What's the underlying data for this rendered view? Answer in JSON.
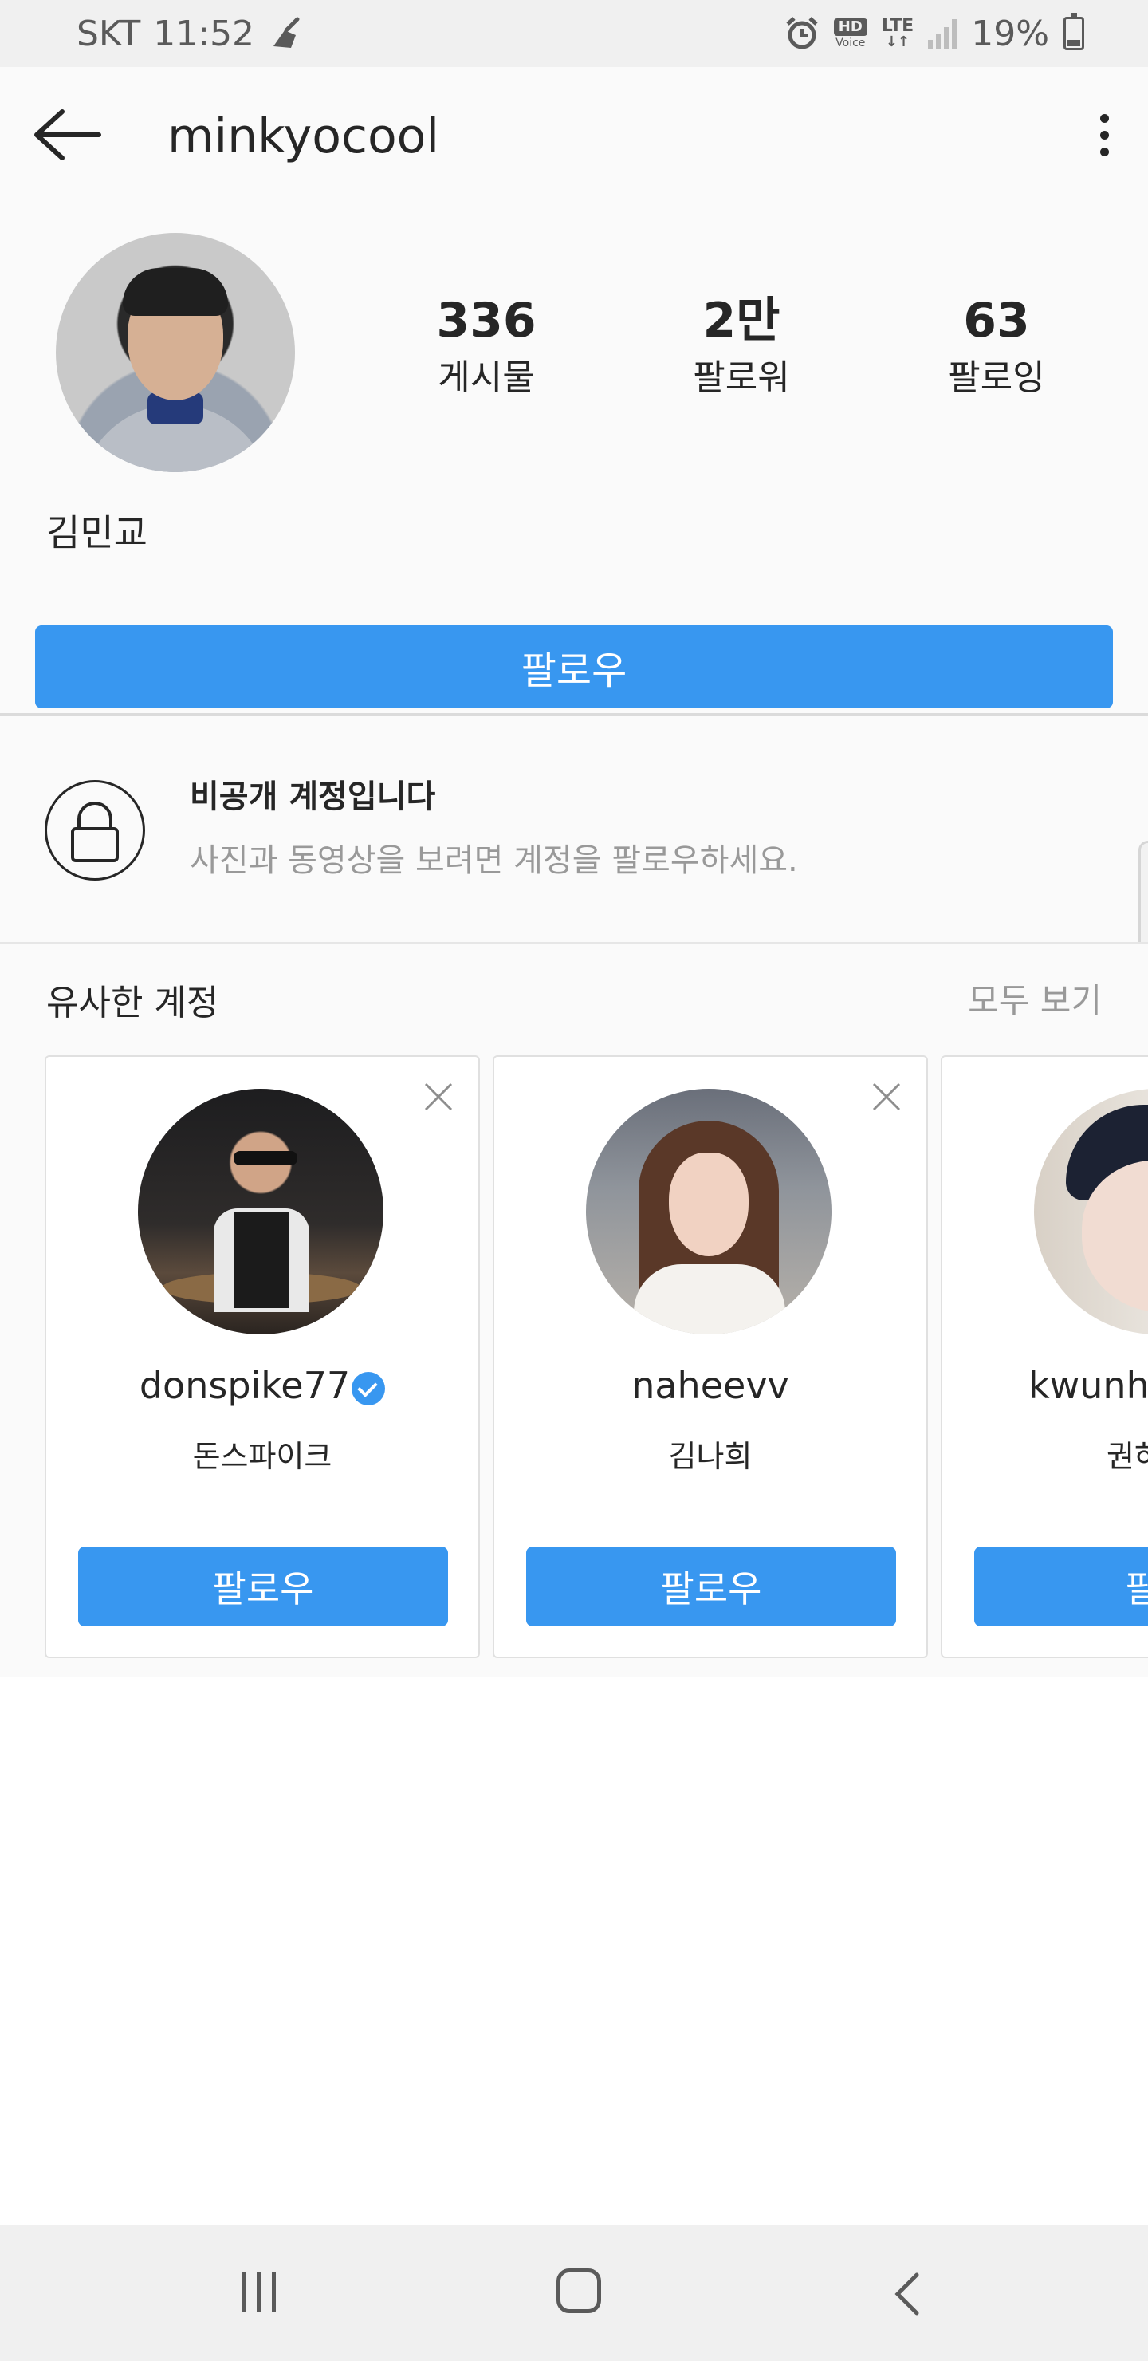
{
  "status_bar": {
    "carrier": "SKT",
    "time": "11:52",
    "hd_label": "HD",
    "voice_label": "Voice",
    "lte_label": "LTE",
    "battery": "19%"
  },
  "top_bar": {
    "username": "minkyocool"
  },
  "profile": {
    "stats": [
      {
        "value": "336",
        "label": "게시물"
      },
      {
        "value": "2만",
        "label": "팔로워"
      },
      {
        "value": "63",
        "label": "팔로잉"
      }
    ],
    "full_name": "김민교",
    "follow_label": "팔로우"
  },
  "private_notice": {
    "title": "비공개 계정입니다",
    "subtitle": "사진과 동영상을 보려면 계정을 팔로우하세요."
  },
  "similar": {
    "title": "유사한 계정",
    "see_all": "모두 보기",
    "cards": [
      {
        "username": "donspike77",
        "name": "돈스파이크",
        "follow_label": "팔로우",
        "verified": true
      },
      {
        "username": "naheevv",
        "name": "김나희",
        "follow_label": "팔로우",
        "verified": false
      },
      {
        "username": "kwunh",
        "name": "권하",
        "follow_label": "팔로",
        "verified": false
      }
    ]
  },
  "colors": {
    "accent": "#3897f0",
    "text": "#262626",
    "muted": "#999999",
    "bg": "#fafafa"
  }
}
